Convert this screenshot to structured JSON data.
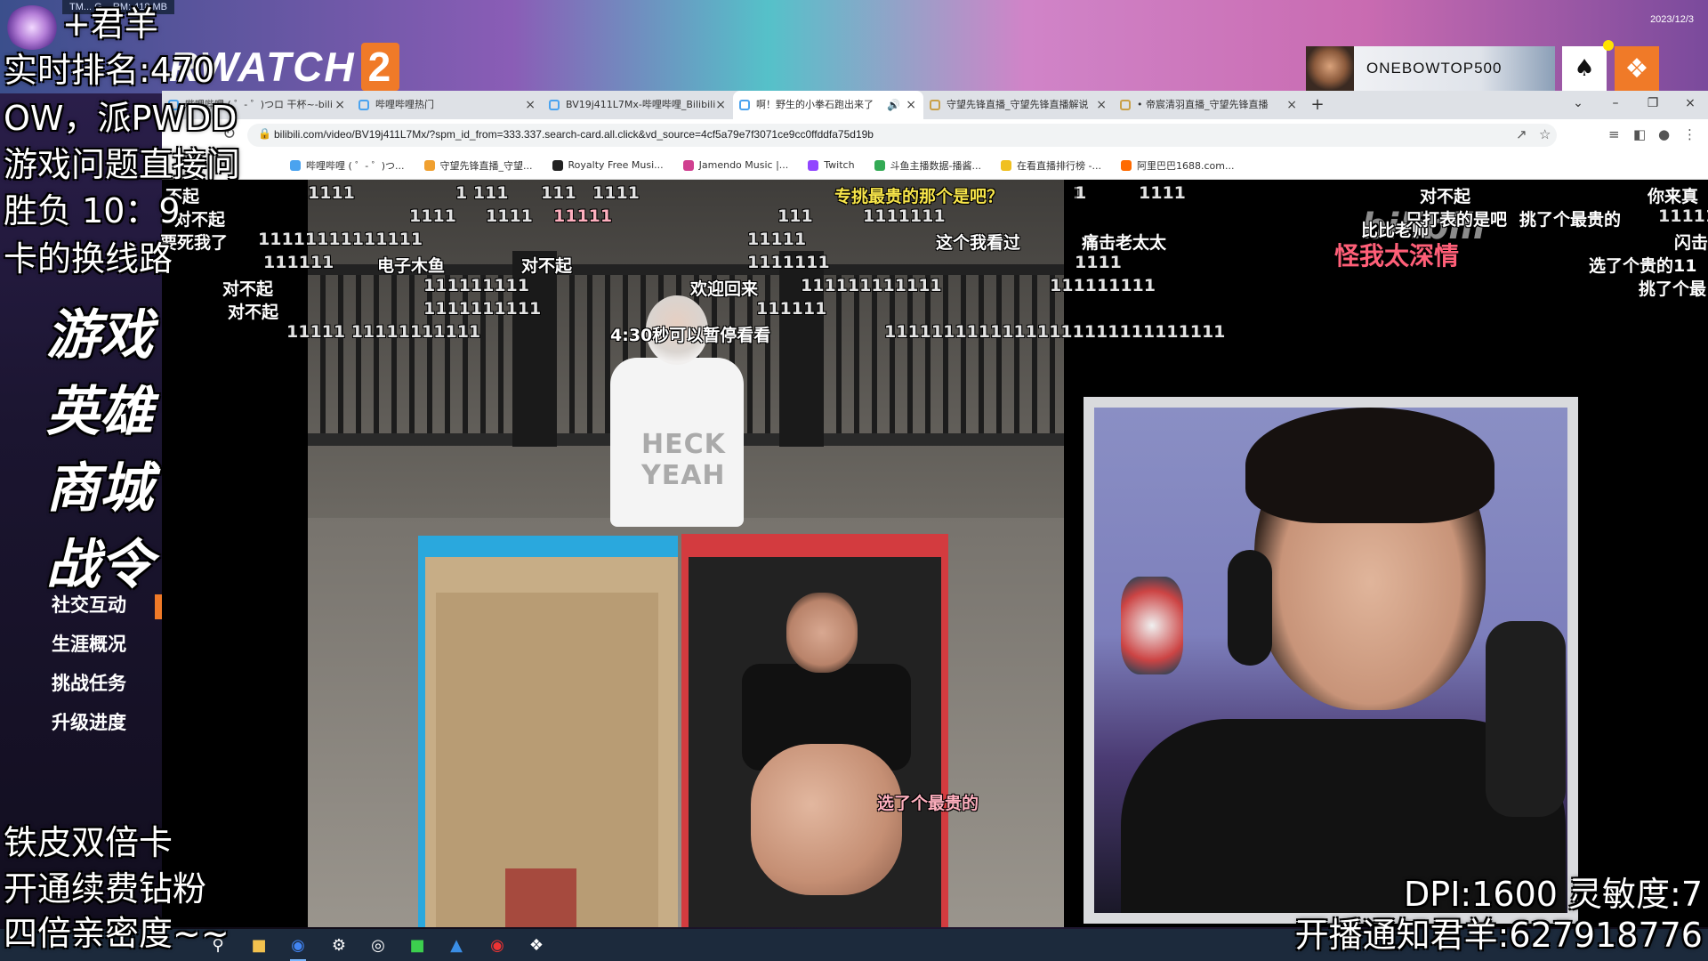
{
  "game": {
    "perf_text": "TM... G... RM: 418 MB",
    "logo_text": "RWATCH",
    "logo_num": "2",
    "side_menu": [
      "社交互动",
      "生涯概况",
      "挑战任务",
      "升级进度"
    ],
    "profile_name": "ONEBOWTOP500"
  },
  "overlay": {
    "top_lines": [
      "+君羊",
      "实时排名:470",
      "OW，派PWDD",
      "游戏问题直接问",
      "胜负 10：9",
      "卡的换线路"
    ],
    "italic_lines": [
      "游戏",
      "英雄",
      "商城",
      "战令"
    ],
    "bottom_left": [
      "铁皮双倍卡",
      "开通续费钻粉",
      "四倍亲密度~~"
    ],
    "bottom_right": [
      "DPI:1600  灵敏度:7",
      "开播通知君羊:627918776"
    ]
  },
  "browser": {
    "tabs": [
      {
        "title": "哔哩哔哩 ( ゜- ゜)つロ 干杯~-bili",
        "active": false,
        "audio": false
      },
      {
        "title": "哔哩哔哩热门",
        "active": false,
        "audio": false
      },
      {
        "title": "BV19j411L7Mx-哔哩哔哩_Bilibili",
        "active": false,
        "audio": false
      },
      {
        "title": "啊！野生的小拳石跑出来了",
        "active": true,
        "audio": true
      },
      {
        "title": "守望先锋直播_守望先锋直播解说",
        "active": false,
        "audio": false
      },
      {
        "title": "• 帝宸清羽直播_守望先锋直播",
        "active": false,
        "audio": false
      }
    ],
    "url": "bilibili.com/video/BV19j411L7Mx/?spm_id_from=333.337.search-card.all.click&vd_source=4cf5a79e7f3071ce9cc0ffddfa75d19b",
    "bookmarks": [
      {
        "label": "哔哩哔哩 ( ゜- ゜)つ...",
        "color": "#4aa3ef"
      },
      {
        "label": "守望先锋直播_守望...",
        "color": "#f0a030"
      },
      {
        "label": "Royalty Free Musi...",
        "color": "#222222"
      },
      {
        "label": "Jamendo Music |...",
        "color": "#d04090"
      },
      {
        "label": "Twitch",
        "color": "#9146ff"
      },
      {
        "label": "斗鱼主播数据-播酱...",
        "color": "#33aa55"
      },
      {
        "label": "在看直播排行榜 -...",
        "color": "#f0c020"
      },
      {
        "label": "阿里巴巴1688.com...",
        "color": "#ff6a00"
      }
    ]
  },
  "video": {
    "shirt_text": "HECK YEAH",
    "danmaku": [
      {
        "text": "1111",
        "cls": "dm-gray",
        "x": 0,
        "y": 0
      },
      {
        "text": "不起",
        "cls": "",
        "x": 0,
        "y": 0
      },
      {
        "text": "对不起",
        "cls": "",
        "x": 0,
        "y": 0
      },
      {
        "text": "要死我了",
        "cls": "",
        "x": 0,
        "y": 0
      },
      {
        "text": "1  111",
        "cls": "dm-gray",
        "x": 0,
        "y": 0
      },
      {
        "text": "111",
        "cls": "dm-gray",
        "x": 0,
        "y": 0
      },
      {
        "text": "1111",
        "cls": "dm-gray",
        "x": 0,
        "y": 0
      },
      {
        "text": "1111",
        "cls": "dm-gray",
        "x": 0,
        "y": 0
      },
      {
        "text": "1111",
        "cls": "dm-gray",
        "x": 0,
        "y": 0
      },
      {
        "text": "11111",
        "cls": "dm-red",
        "x": 0,
        "y": 0
      },
      {
        "text": "专挑最贵的那个是吧？",
        "cls": "dm-yellow",
        "x": 0,
        "y": 0
      },
      {
        "text": "1",
        "cls": "dm-gray",
        "x": 0,
        "y": 0
      },
      {
        "text": "111",
        "cls": "dm-gray",
        "x": 0,
        "y": 0
      },
      {
        "text": "1111111",
        "cls": "dm-gray",
        "x": 0,
        "y": 0
      },
      {
        "text": "11111111111111",
        "cls": "dm-gray",
        "x": 0,
        "y": 0
      },
      {
        "text": "11111",
        "cls": "dm-gray",
        "x": 0,
        "y": 0
      },
      {
        "text": "这个我看过",
        "cls": "",
        "x": 0,
        "y": 0
      },
      {
        "text": "111111",
        "cls": "dm-gray",
        "x": 0,
        "y": 0
      },
      {
        "text": "电子木鱼",
        "cls": "",
        "x": 0,
        "y": 0
      },
      {
        "text": "对不起",
        "cls": "",
        "x": 0,
        "y": 0
      },
      {
        "text": "1111111",
        "cls": "dm-gray",
        "x": 0,
        "y": 0
      },
      {
        "text": "对不起",
        "cls": "",
        "x": 0,
        "y": 0
      },
      {
        "text": "111111111",
        "cls": "dm-gray",
        "x": 0,
        "y": 0
      },
      {
        "text": "欢迎回来",
        "cls": "",
        "x": 0,
        "y": 0
      },
      {
        "text": "111111111111",
        "cls": "dm-gray",
        "x": 0,
        "y": 0
      },
      {
        "text": "对不起",
        "cls": "",
        "x": 0,
        "y": 0
      },
      {
        "text": "1111111111",
        "cls": "dm-gray",
        "x": 0,
        "y": 0
      },
      {
        "text": "111111",
        "cls": "dm-gray",
        "x": 0,
        "y": 0
      },
      {
        "text": "11111   11111111111",
        "cls": "dm-gray",
        "x": 0,
        "y": 0
      },
      {
        "text": "4:30秒可以暂停看看",
        "cls": "",
        "x": 0,
        "y": 0
      },
      {
        "text": "11111111111111111111111111111",
        "cls": "dm-gray",
        "x": 0,
        "y": 0
      },
      {
        "text": "1",
        "cls": "dm-gray",
        "x": 0,
        "y": 0
      },
      {
        "text": "1111",
        "cls": "dm-gray",
        "x": 0,
        "y": 0
      },
      {
        "text": "痛击老太太",
        "cls": "",
        "x": 0,
        "y": 0
      },
      {
        "text": "1111",
        "cls": "dm-gray",
        "x": 0,
        "y": 0
      },
      {
        "text": "111111111",
        "cls": "dm-gray",
        "x": 0,
        "y": 0
      },
      {
        "text": "对不起",
        "cls": "",
        "x": 0,
        "y": 0
      },
      {
        "text": "比比老师",
        "cls": "",
        "x": 0,
        "y": 0
      },
      {
        "text": "只打表的是吧",
        "cls": "",
        "x": 0,
        "y": 0
      },
      {
        "text": "挑了个最贵的",
        "cls": "",
        "x": 0,
        "y": 0
      },
      {
        "text": "怪我太深情",
        "cls": "dm-pink",
        "x": 0,
        "y": 0
      },
      {
        "text": "你来真",
        "cls": "",
        "x": 0,
        "y": 0
      },
      {
        "text": "11111",
        "cls": "dm-gray",
        "x": 0,
        "y": 0
      },
      {
        "text": "闪击",
        "cls": "",
        "x": 0,
        "y": 0
      },
      {
        "text": "选了个贵的11",
        "cls": "",
        "x": 0,
        "y": 0
      },
      {
        "text": "挑了个最",
        "cls": "",
        "x": 0,
        "y": 0
      },
      {
        "text": "选了个最贵的",
        "cls": "dm-red",
        "x": 0,
        "y": 0
      }
    ],
    "watermark": "bilibili"
  },
  "taskbar": {
    "apps": [
      "search-icon",
      "file-explorer-icon",
      "chrome-icon",
      "steam-icon",
      "obs-icon",
      "wechat-icon",
      "tencent-icon",
      "netease-icon",
      "overwatch-icon"
    ],
    "date": "2023/12/3"
  },
  "colors": {
    "accent": "#f07a28",
    "bili_pink": "#ff5f78",
    "danmaku_yellow": "#f7e54a"
  }
}
